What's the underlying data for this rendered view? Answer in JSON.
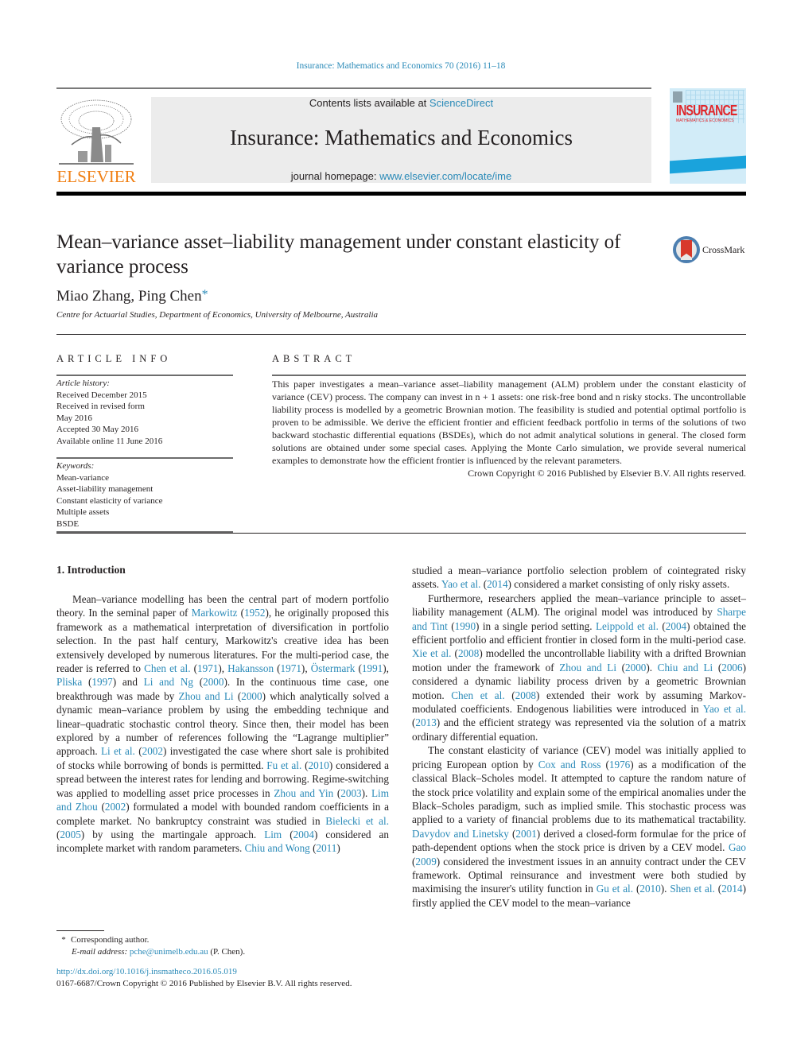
{
  "header": {
    "citation": "Insurance: Mathematics and Economics 70 (2016) 11–18",
    "contents_prefix": "Contents lists available at ",
    "contents_link": "ScienceDirect",
    "journal_title": "Insurance: Mathematics and Economics",
    "homepage_prefix": "journal homepage: ",
    "homepage_link": "www.elsevier.com/locate/ime",
    "publisher_logo": "ELSEVIER",
    "cover_title": "INSURANCE",
    "cover_subtitle": "MATHEMATICS & ECONOMICS",
    "colors": {
      "link": "#2a8ab8",
      "elsevier_orange": "#f07f13",
      "banner_bg": "#ececec"
    }
  },
  "article": {
    "title": "Mean–variance asset–liability management under constant elasticity of variance process",
    "crossmark_label": "CrossMark",
    "authors": "Miao Zhang, Ping Chen",
    "author_mark": "*",
    "affiliation": "Centre for Actuarial Studies, Department of Economics, University of Melbourne, Australia"
  },
  "article_info": {
    "label": "ARTICLE INFO",
    "history_label": "Article history:",
    "history": [
      "Received December 2015",
      "Received in revised form",
      "May 2016",
      "Accepted 30 May 2016",
      "Available online 11 June 2016"
    ],
    "keywords_label": "Keywords:",
    "keywords": [
      "Mean-variance",
      "Asset-liability management",
      "Constant elasticity of variance",
      "Multiple assets",
      "BSDE"
    ]
  },
  "abstract": {
    "label": "ABSTRACT",
    "text": "This paper investigates a mean–variance asset–liability management (ALM) problem under the constant elasticity of variance (CEV) process. The company can invest in n + 1 assets: one risk-free bond and n risky stocks. The uncontrollable liability process is modelled by a geometric Brownian motion. The feasibility is studied and potential optimal portfolio is proven to be admissible. We derive the efficient frontier and efficient feedback portfolio in terms of the solutions of two backward stochastic differential equations (BSDEs), which do not admit analytical solutions in general. The closed form solutions are obtained under some special cases. Applying the Monte Carlo simulation, we provide several numerical examples to demonstrate how the efficient frontier is influenced by the relevant parameters.",
    "copyright": "Crown Copyright © 2016 Published by Elsevier B.V. All rights reserved."
  },
  "body": {
    "section_heading": "1.  Introduction",
    "col1": [
      {
        "t": "Mean–variance modelling has been the central part of modern portfolio theory. In the seminal paper of "
      },
      {
        "l": "Markowitz"
      },
      {
        "t": " ("
      },
      {
        "l": "1952"
      },
      {
        "t": "), he originally proposed this framework as a mathematical interpretation of diversification in portfolio selection. In the past half century, Markowitz's creative idea has been extensively developed by numerous literatures. For the multi-period case, the reader is referred to "
      },
      {
        "l": "Chen et al."
      },
      {
        "t": " ("
      },
      {
        "l": "1971"
      },
      {
        "t": "), "
      },
      {
        "l": "Hakansson"
      },
      {
        "t": " ("
      },
      {
        "l": "1971"
      },
      {
        "t": "), "
      },
      {
        "l": "Östermark"
      },
      {
        "t": " ("
      },
      {
        "l": "1991"
      },
      {
        "t": "), "
      },
      {
        "l": "Pliska"
      },
      {
        "t": " ("
      },
      {
        "l": "1997"
      },
      {
        "t": ") and "
      },
      {
        "l": "Li and Ng"
      },
      {
        "t": " ("
      },
      {
        "l": "2000"
      },
      {
        "t": "). In the continuous time case, one breakthrough was made by "
      },
      {
        "l": "Zhou and Li"
      },
      {
        "t": " ("
      },
      {
        "l": "2000"
      },
      {
        "t": ") which analytically solved a dynamic mean–variance problem by using the embedding technique and linear–quadratic stochastic control theory. Since then, their model has been explored by a number of references following the “Lagrange multiplier” approach. "
      },
      {
        "l": "Li et al."
      },
      {
        "t": " ("
      },
      {
        "l": "2002"
      },
      {
        "t": ") investigated the case where short sale is prohibited of stocks while borrowing of bonds is permitted. "
      },
      {
        "l": "Fu et al."
      },
      {
        "t": " ("
      },
      {
        "l": "2010"
      },
      {
        "t": ") considered a spread between the interest rates for lending and borrowing. Regime-switching was applied to modelling asset price processes in "
      },
      {
        "l": "Zhou and Yin"
      },
      {
        "t": " ("
      },
      {
        "l": "2003"
      },
      {
        "t": "). "
      },
      {
        "l": "Lim and Zhou"
      },
      {
        "t": " ("
      },
      {
        "l": "2002"
      },
      {
        "t": ") formulated a model with bounded random coefficients in a complete market. No bankruptcy constraint was studied in "
      },
      {
        "l": "Bielecki et al."
      },
      {
        "t": " ("
      },
      {
        "l": "2005"
      },
      {
        "t": ") by using the martingale approach. "
      },
      {
        "l": "Lim"
      },
      {
        "t": " ("
      },
      {
        "l": "2004"
      },
      {
        "t": ") considered an incomplete market with random parameters. "
      },
      {
        "l": "Chiu and Wong"
      },
      {
        "t": " ("
      },
      {
        "l": "2011"
      },
      {
        "t": ")"
      }
    ],
    "col2_p1": [
      {
        "t": "studied a mean–variance portfolio selection problem of cointegrated risky assets. "
      },
      {
        "l": "Yao et al."
      },
      {
        "t": " ("
      },
      {
        "l": "2014"
      },
      {
        "t": ") considered a market consisting of only risky assets."
      }
    ],
    "col2_p2": [
      {
        "t": "Furthermore, researchers applied the mean–variance principle to asset–liability management (ALM). The original model was introduced by "
      },
      {
        "l": "Sharpe and Tint"
      },
      {
        "t": " ("
      },
      {
        "l": "1990"
      },
      {
        "t": ") in a single period setting. "
      },
      {
        "l": "Leippold et al."
      },
      {
        "t": " ("
      },
      {
        "l": "2004"
      },
      {
        "t": ") obtained the efficient portfolio and efficient frontier in closed form in the multi-period case. "
      },
      {
        "l": "Xie et al."
      },
      {
        "t": " ("
      },
      {
        "l": "2008"
      },
      {
        "t": ") modelled the uncontrollable liability with a drifted Brownian motion under the framework of "
      },
      {
        "l": "Zhou and Li"
      },
      {
        "t": " ("
      },
      {
        "l": "2000"
      },
      {
        "t": "). "
      },
      {
        "l": "Chiu and Li"
      },
      {
        "t": " ("
      },
      {
        "l": "2006"
      },
      {
        "t": ") considered a dynamic liability process driven by a geometric Brownian motion. "
      },
      {
        "l": "Chen et al."
      },
      {
        "t": " ("
      },
      {
        "l": "2008"
      },
      {
        "t": ") extended their work by assuming Markov-modulated coefficients. Endogenous liabilities were introduced in "
      },
      {
        "l": "Yao et al."
      },
      {
        "t": " ("
      },
      {
        "l": "2013"
      },
      {
        "t": ") and the efficient strategy was represented via the solution of a matrix ordinary differential equation."
      }
    ],
    "col2_p3": [
      {
        "t": "The constant elasticity of variance (CEV) model was initially applied to pricing European option by "
      },
      {
        "l": "Cox and Ross"
      },
      {
        "t": " ("
      },
      {
        "l": "1976"
      },
      {
        "t": ") as a modification of the classical Black–Scholes model. It attempted to capture the random nature of the stock price volatility and explain some of the empirical anomalies under the Black–Scholes paradigm, such as implied smile. This stochastic process was applied to a variety of financial problems due to its mathematical tractability. "
      },
      {
        "l": "Davydov and Linetsky"
      },
      {
        "t": " ("
      },
      {
        "l": "2001"
      },
      {
        "t": ") derived a closed-form formulae for the price of path-dependent options when the stock price is driven by a CEV model. "
      },
      {
        "l": "Gao"
      },
      {
        "t": " ("
      },
      {
        "l": "2009"
      },
      {
        "t": ") considered the investment issues in an annuity contract under the CEV framework. Optimal reinsurance and investment were both studied by maximising the insurer's utility function in "
      },
      {
        "l": "Gu et al."
      },
      {
        "t": " ("
      },
      {
        "l": "2010"
      },
      {
        "t": "). "
      },
      {
        "l": "Shen et al."
      },
      {
        "t": " ("
      },
      {
        "l": "2014"
      },
      {
        "t": ") firstly applied the CEV model to the  mean–variance"
      }
    ]
  },
  "footnotes": {
    "star": "*",
    "corresponding": "Corresponding author.",
    "email_label": "E-mail address:",
    "email": "pche@unimelb.edu.au",
    "email_suffix": " (P. Chen).",
    "doi": "http://dx.doi.org/10.1016/j.insmatheco.2016.05.019",
    "issn_copyright": "0167-6687/Crown Copyright © 2016 Published by Elsevier B.V. All rights reserved."
  }
}
